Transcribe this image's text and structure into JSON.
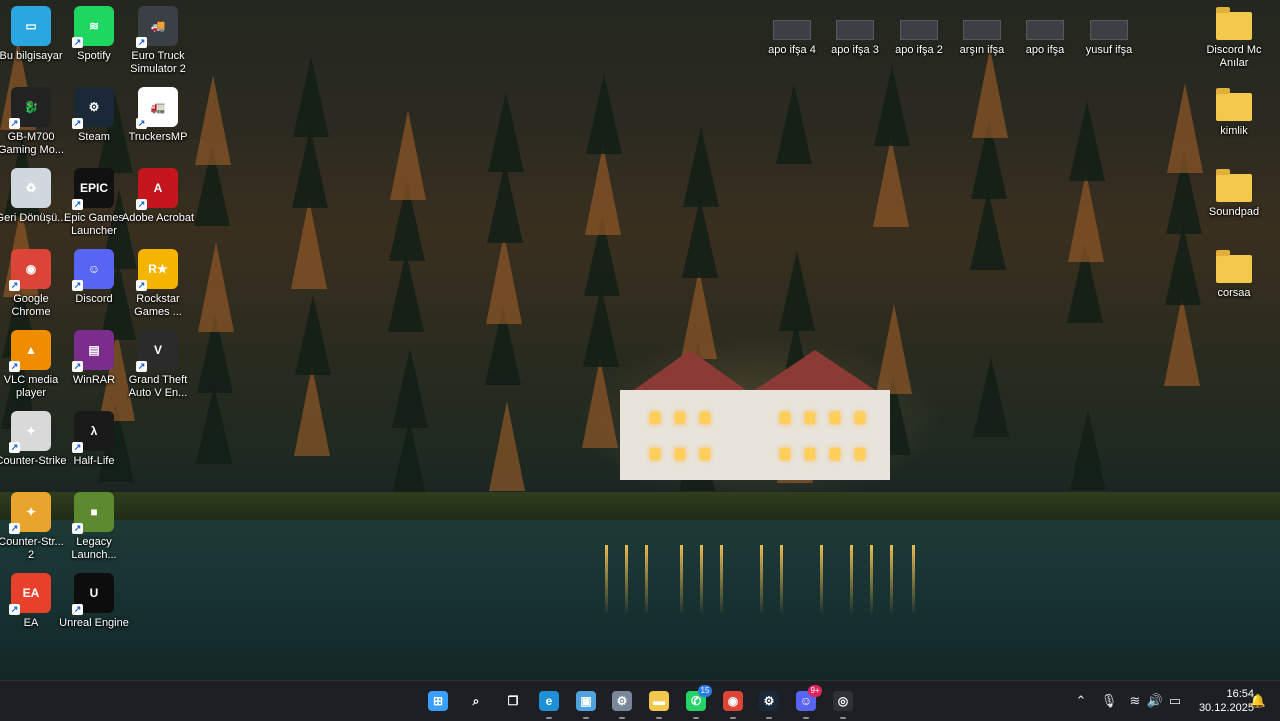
{
  "desktop_icons_left": [
    {
      "label": "Bu bilgisayar",
      "icon": "computer-icon",
      "color": "#2aa7e0",
      "glyph": "▭"
    },
    {
      "label": "Spotify",
      "icon": "spotify-icon",
      "color": "#1ed760",
      "glyph": "≋"
    },
    {
      "label": "Euro Truck Simulator 2",
      "icon": "truck-icon",
      "color": "#3b3f46",
      "glyph": "🚚"
    },
    {
      "label": "GB-M700 Gaming Mo...",
      "icon": "dragon-icon",
      "color": "#222222",
      "glyph": "🐉"
    },
    {
      "label": "Steam",
      "icon": "steam-icon",
      "color": "#1b2838",
      "glyph": "⚙"
    },
    {
      "label": "TruckersMP",
      "icon": "truckersmp-icon",
      "color": "#ffffff",
      "glyph": "🚛"
    },
    {
      "label": "Geri Dönüşü...",
      "icon": "recycle-bin-icon",
      "color": "#cfd8dc",
      "glyph": "♻"
    },
    {
      "label": "Epic Games Launcher",
      "icon": "epic-games-icon",
      "color": "#111111",
      "glyph": "EPIC"
    },
    {
      "label": "Adobe Acrobat",
      "icon": "acrobat-icon",
      "color": "#c4161c",
      "glyph": "A"
    },
    {
      "label": "Google Chrome",
      "icon": "chrome-icon",
      "color": "#db4437",
      "glyph": "◉"
    },
    {
      "label": "Discord",
      "icon": "discord-icon",
      "color": "#5865f2",
      "glyph": "☺"
    },
    {
      "label": "Rockstar Games ...",
      "icon": "rockstar-icon",
      "color": "#f4b400",
      "glyph": "R★"
    },
    {
      "label": "VLC media player",
      "icon": "vlc-icon",
      "color": "#f08c00",
      "glyph": "▲"
    },
    {
      "label": "WinRAR",
      "icon": "winrar-icon",
      "color": "#7a2d8c",
      "glyph": "▤"
    },
    {
      "label": "Grand Theft Auto V En...",
      "icon": "gta-icon",
      "color": "#2b2b2b",
      "glyph": "V"
    },
    {
      "label": "Counter-Strike",
      "icon": "counter-strike-icon",
      "color": "#d9d9d9",
      "glyph": "✦"
    },
    {
      "label": "Half-Life",
      "icon": "half-life-icon",
      "color": "#1a1a1a",
      "glyph": "λ"
    },
    {
      "label": "Counter-Str... 2",
      "icon": "counter-strike-2-icon",
      "color": "#e8a42c",
      "glyph": "✦"
    },
    {
      "label": "Legacy Launch...",
      "icon": "minecraft-icon",
      "color": "#5d8a2f",
      "glyph": "■"
    },
    {
      "label": "EA",
      "icon": "ea-icon",
      "color": "#e8412b",
      "glyph": "EA"
    },
    {
      "label": "Unreal Engine",
      "icon": "unreal-engine-icon",
      "color": "#0d0d0d",
      "glyph": "U"
    }
  ],
  "desktop_icons_top": [
    {
      "label": "apo ifşa 4"
    },
    {
      "label": "apo ifşa 3"
    },
    {
      "label": "apo ifşa 2"
    },
    {
      "label": "arşın ifşa"
    },
    {
      "label": "apo ifşa"
    },
    {
      "label": "yusuf ifşa"
    }
  ],
  "desktop_icons_right": [
    {
      "label": "Discord Mc Anılar"
    },
    {
      "label": "kimlik"
    },
    {
      "label": "Soundpad"
    },
    {
      "label": "corsaa"
    }
  ],
  "taskbar": {
    "apps": [
      {
        "name": "start-button",
        "icon": "windows-icon",
        "color": "#3aa0ff",
        "glyph": "⊞"
      },
      {
        "name": "search-button",
        "icon": "search-icon",
        "color": "transparent",
        "glyph": "⌕"
      },
      {
        "name": "task-view-button",
        "icon": "task-view-icon",
        "color": "transparent",
        "glyph": "❐"
      },
      {
        "name": "edge-button",
        "icon": "edge-icon",
        "color": "#1f8fd6",
        "glyph": "e"
      },
      {
        "name": "monitor-app-button",
        "icon": "monitor-icon",
        "color": "#4fa3e0",
        "glyph": "▣"
      },
      {
        "name": "settings-button",
        "icon": "gear-icon",
        "color": "#7a8699",
        "glyph": "⚙"
      },
      {
        "name": "file-explorer-button",
        "icon": "folder-icon",
        "color": "#f2c94c",
        "glyph": "▬"
      },
      {
        "name": "whatsapp-button",
        "icon": "whatsapp-icon",
        "color": "#25d366",
        "glyph": "✆",
        "badge": "15"
      },
      {
        "name": "chrome-taskbar-button",
        "icon": "chrome-icon",
        "color": "#db4437",
        "glyph": "◉"
      },
      {
        "name": "steam-taskbar-button",
        "icon": "steam-icon",
        "color": "#1b2838",
        "glyph": "⚙"
      },
      {
        "name": "discord-taskbar-button",
        "icon": "discord-icon",
        "color": "#5865f2",
        "glyph": "☺",
        "badge": "9+"
      },
      {
        "name": "obs-button",
        "icon": "record-icon",
        "color": "#2f3136",
        "glyph": "◎"
      }
    ],
    "tray": {
      "chevron": "⌃",
      "mic": "🎙",
      "wifi": "≋",
      "volume": "🔊",
      "battery": "▭",
      "notification": "🔔"
    },
    "time": "16:54",
    "date": "30.12.2025"
  }
}
